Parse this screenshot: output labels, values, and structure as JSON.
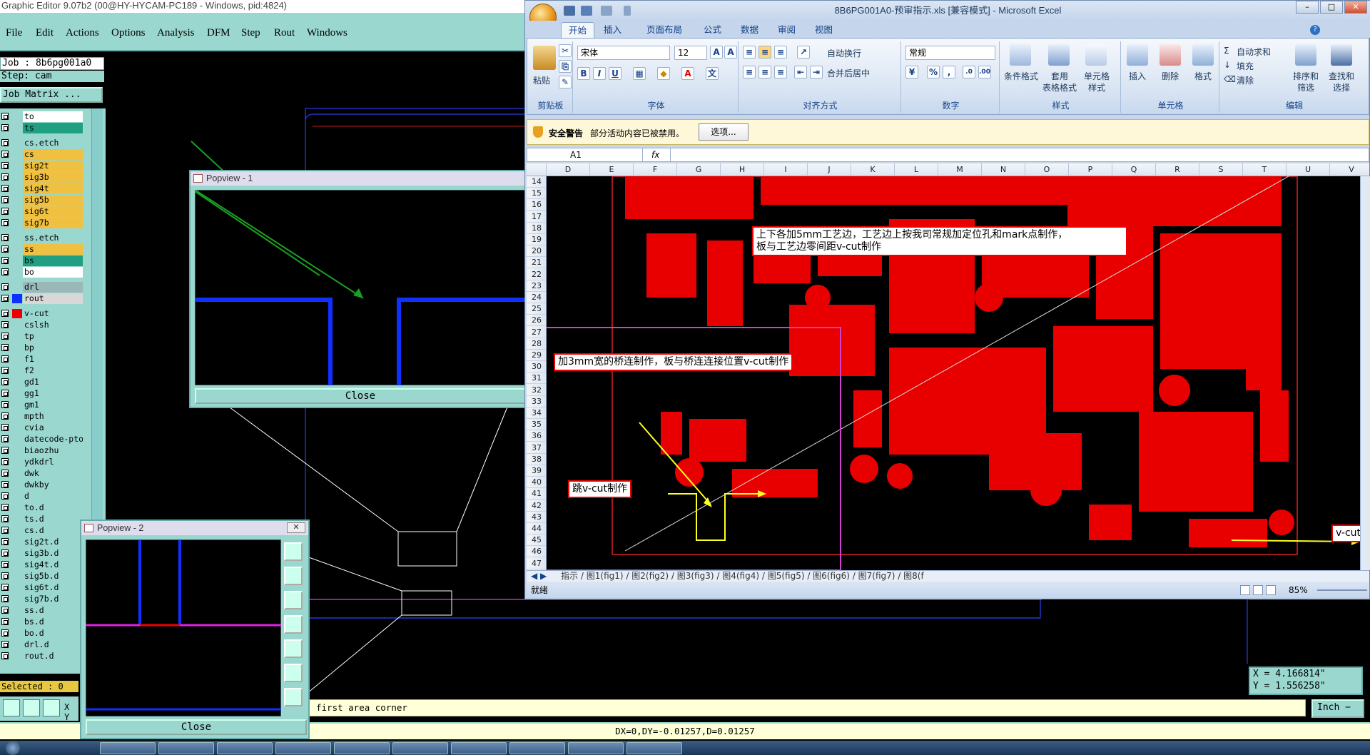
{
  "genesis": {
    "title": "Graphic Editor 9.07b2 (00@HY-HYCAM-PC189 - Windows, pid:4824)",
    "menu": [
      "File",
      "Edit",
      "Actions",
      "Options",
      "Analysis",
      "DFM",
      "Step",
      "Rout",
      "Windows"
    ],
    "job": "Job : 8b6pg001a0",
    "step": "Step: cam",
    "job_matrix_button": "Job Matrix ...",
    "layers": [
      {
        "name": "to",
        "color": "#ffffff"
      },
      {
        "name": "ts",
        "color": "#20a080"
      },
      {
        "name": "cs.etch",
        "color": "#9ad7cf"
      },
      {
        "name": "cs",
        "color": "#f0c040"
      },
      {
        "name": "sig2t",
        "color": "#f0c040"
      },
      {
        "name": "sig3b",
        "color": "#f0c040"
      },
      {
        "name": "sig4t",
        "color": "#f0c040"
      },
      {
        "name": "sig5b",
        "color": "#f0c040"
      },
      {
        "name": "sig6t",
        "color": "#f0c040"
      },
      {
        "name": "sig7b",
        "color": "#f0c040"
      },
      {
        "name": "ss.etch",
        "color": "#9ad7cf"
      },
      {
        "name": "ss",
        "color": "#f0c040"
      },
      {
        "name": "bs",
        "color": "#20a080"
      },
      {
        "name": "bo",
        "color": "#ffffff"
      },
      {
        "name": "drl",
        "color": "#9ab8b8"
      },
      {
        "name": "rout",
        "color": "#d8d8d8"
      },
      {
        "name": "v-cut",
        "color": "#9ad7cf"
      },
      {
        "name": "cslsh",
        "color": "#9ad7cf"
      },
      {
        "name": "tp",
        "color": "#9ad7cf"
      },
      {
        "name": "bp",
        "color": "#9ad7cf"
      },
      {
        "name": "f1",
        "color": "#9ad7cf"
      },
      {
        "name": "f2",
        "color": "#9ad7cf"
      },
      {
        "name": "gd1",
        "color": "#9ad7cf"
      },
      {
        "name": "gg1",
        "color": "#9ad7cf"
      },
      {
        "name": "gm1",
        "color": "#9ad7cf"
      },
      {
        "name": "mpth",
        "color": "#9ad7cf"
      },
      {
        "name": "cvia",
        "color": "#9ad7cf"
      },
      {
        "name": "datecode-pto",
        "color": "#9ad7cf"
      },
      {
        "name": "biaozhu",
        "color": "#9ad7cf"
      },
      {
        "name": "ydkdrl",
        "color": "#9ad7cf"
      },
      {
        "name": "dwk",
        "color": "#9ad7cf"
      },
      {
        "name": "dwkby",
        "color": "#9ad7cf"
      },
      {
        "name": "d",
        "color": "#9ad7cf"
      },
      {
        "name": "to.d",
        "color": "#9ad7cf"
      },
      {
        "name": "ts.d",
        "color": "#9ad7cf"
      },
      {
        "name": "cs.d",
        "color": "#9ad7cf"
      },
      {
        "name": "sig2t.d",
        "color": "#9ad7cf"
      },
      {
        "name": "sig3b.d",
        "color": "#9ad7cf"
      },
      {
        "name": "sig4t.d",
        "color": "#9ad7cf"
      },
      {
        "name": "sig5b.d",
        "color": "#9ad7cf"
      },
      {
        "name": "sig6t.d",
        "color": "#9ad7cf"
      },
      {
        "name": "sig7b.d",
        "color": "#9ad7cf"
      },
      {
        "name": "ss.d",
        "color": "#9ad7cf"
      },
      {
        "name": "bs.d",
        "color": "#9ad7cf"
      },
      {
        "name": "bo.d",
        "color": "#9ad7cf"
      },
      {
        "name": "drl.d",
        "color": "#9ad7cf"
      },
      {
        "name": "rout.d",
        "color": "#9ad7cf"
      }
    ],
    "selected": "Selected : 0",
    "prompt_prefix": "X Y",
    "prompt": "first area corner",
    "coords_x": "X = 4.166814\"",
    "coords_y": "Y = 1.556258\"",
    "unit": "Inch",
    "status": "DX=0,DY=-0.01257,D=0.01257",
    "popview1": {
      "title": "Popview - 1",
      "close": "Close"
    },
    "popview2": {
      "title": "Popview - 2",
      "close": "Close"
    }
  },
  "excel": {
    "title": "8B6PG001A0-预审指示.xls [兼容模式] - Microsoft Excel",
    "tabs": [
      "开始",
      "插入",
      "页面布局",
      "公式",
      "数据",
      "审阅",
      "视图"
    ],
    "ribbon": {
      "clipboard": {
        "paste": "粘贴",
        "group": "剪贴板"
      },
      "font": {
        "name": "宋体",
        "size": "12",
        "group": "字体",
        "bold": "B",
        "italic": "I",
        "underline": "U"
      },
      "alignment": {
        "wrap": "自动换行",
        "merge": "合并后居中",
        "group": "对齐方式"
      },
      "number": {
        "format": "常规",
        "group": "数字",
        "percent": "%",
        "comma": ","
      },
      "styles": {
        "cond": "条件格式",
        "table1": "套用",
        "table2": "表格格式",
        "cell1": "单元格",
        "cell2": "样式",
        "group": "样式"
      },
      "cells": {
        "insert": "插入",
        "delete": "删除",
        "format": "格式",
        "group": "单元格"
      },
      "editing": {
        "autosum": "自动求和",
        "fill": "填充",
        "clear": "清除",
        "sort1": "排序和",
        "sort2": "筛选",
        "find1": "查找和",
        "find2": "选择",
        "group": "编辑"
      }
    },
    "security_label": "安全警告",
    "security_text": "部分活动内容已被禁用。",
    "security_button": "选项...",
    "namebox": "A1",
    "fx": "fx",
    "columns": [
      "D",
      "E",
      "F",
      "G",
      "H",
      "I",
      "J",
      "K",
      "L",
      "M",
      "N",
      "O",
      "P",
      "Q",
      "R",
      "S",
      "T",
      "U",
      "V"
    ],
    "rows": [
      "14",
      "15",
      "16",
      "17",
      "18",
      "19",
      "20",
      "21",
      "22",
      "23",
      "24",
      "25",
      "26",
      "27",
      "28",
      "29",
      "30",
      "31",
      "32",
      "33",
      "34",
      "35",
      "36",
      "37",
      "38",
      "39",
      "40",
      "41",
      "42",
      "43",
      "44",
      "45",
      "46",
      "47"
    ],
    "callouts": {
      "c1_line1": "上下各加5mm工艺边，工艺边上按我司常规加定位孔和mark点制作，",
      "c1_line2": "板与工艺边零间距v-cut制作",
      "c2": "加3mm宽的桥连制作，板与桥连连接位置v-cut制作",
      "c3": "跳v-cut制作",
      "c4": "v-cut"
    },
    "sheet_tabs": "指示 / 图1(fig1) / 图2(fig2) / 图3(fig3) / 图4(fig4) / 图5(fig5) / 图6(fig6) / 图7(fig7) / 图8(f",
    "status_ready": "就绪",
    "zoom": "85%"
  }
}
